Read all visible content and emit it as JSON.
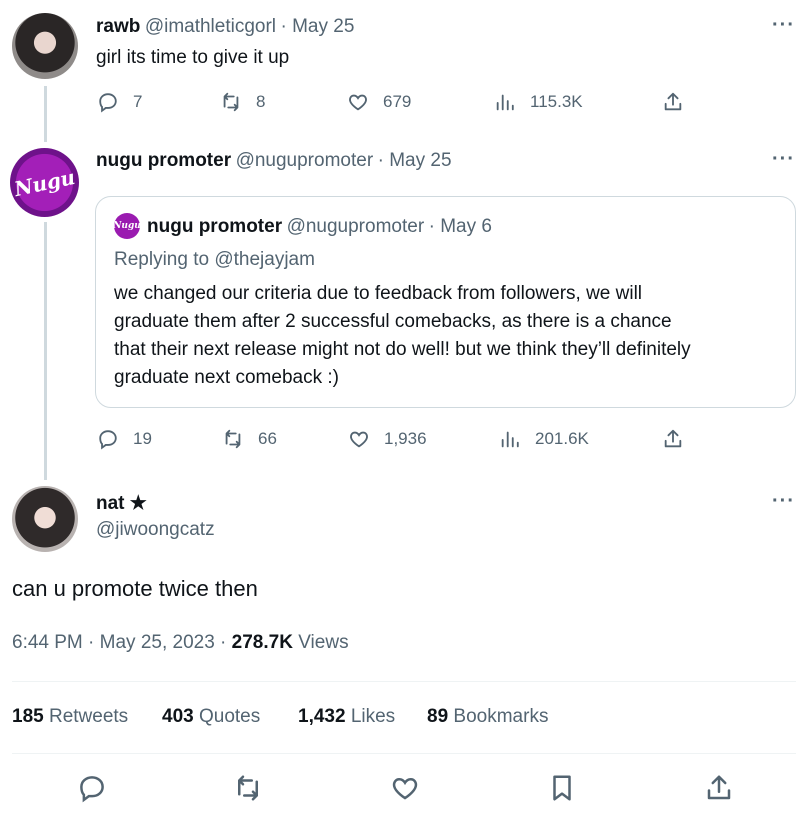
{
  "tweets": [
    {
      "name": "rawb",
      "handle": "@imathleticgorl",
      "date": "· May 25",
      "text": "girl its time to give it up",
      "replies": "7",
      "retweets": "8",
      "likes": "679",
      "views": "115.3K"
    },
    {
      "name": "nugu promoter",
      "handle": "@nugupromoter",
      "date": "· May 25",
      "avatar_text": "Nugu",
      "quote": {
        "name": "nugu promoter",
        "handle": "@nugupromoter",
        "date": "· May 6",
        "avatar_text": "Nugu",
        "replying_to": "Replying to @thejayjam",
        "lines": [
          "we changed our criteria due to feedback from followers, we will",
          "graduate them after 2 successful comebacks, as there is a chance",
          "that their next release might not do well! but we think they’ll definitely",
          "graduate next comeback :)"
        ]
      },
      "replies": "19",
      "retweets": "66",
      "likes": "1,936",
      "views": "201.6K"
    }
  ],
  "main_tweet": {
    "name": "nat ★",
    "handle": "@jiwoongcatz",
    "text": "can u promote twice then",
    "timestamp": "6:44 PM · May 25, 2023 · ",
    "views_count": "278.7K",
    "views_label": " Views",
    "stats": {
      "retweets_count": "185",
      "retweets_label": " Retweets",
      "quotes_count": "403",
      "quotes_label": " Quotes",
      "likes_count": "1,432",
      "likes_label": " Likes",
      "bookmarks_count": "89",
      "bookmarks_label": " Bookmarks"
    }
  },
  "more_label": "···",
  "icons": [
    "reply-icon",
    "retweet-icon",
    "like-icon",
    "views-icon",
    "share-icon",
    "bookmark-icon",
    "more-icon"
  ],
  "colors": {
    "text": "#0f1419",
    "secondary": "#536471",
    "border": "#cfd9de",
    "brand_purple": "#9a1bb0"
  }
}
